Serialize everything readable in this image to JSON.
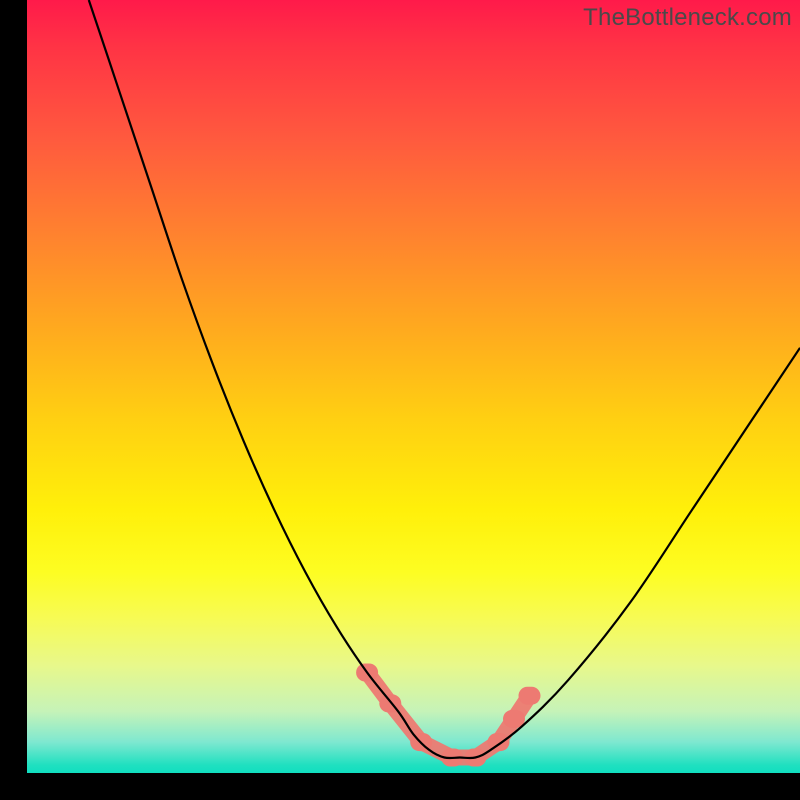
{
  "watermark": "TheBottleneck.com",
  "chart_data": {
    "type": "line",
    "title": "",
    "xlabel": "",
    "ylabel": "",
    "xlim": [
      0,
      100
    ],
    "ylim": [
      0,
      100
    ],
    "series": [
      {
        "name": "bottleneck-curve",
        "x": [
          8,
          12,
          16,
          20,
          24,
          28,
          32,
          36,
          40,
          44,
          48,
          50,
          52,
          54,
          56,
          58,
          60,
          64,
          70,
          78,
          86,
          94,
          100
        ],
        "values": [
          100,
          88,
          76,
          64,
          53,
          43,
          34,
          26,
          19,
          13,
          8,
          5,
          3,
          2,
          2,
          2,
          3,
          6,
          12,
          22,
          34,
          46,
          55
        ]
      }
    ],
    "markers": [
      {
        "name": "marker-a",
        "x": 44,
        "y": 13
      },
      {
        "name": "marker-b",
        "x": 47,
        "y": 9
      },
      {
        "name": "marker-c",
        "x": 51,
        "y": 4
      },
      {
        "name": "marker-d",
        "x": 55,
        "y": 2
      },
      {
        "name": "marker-e",
        "x": 58,
        "y": 2
      },
      {
        "name": "marker-f",
        "x": 61,
        "y": 4
      },
      {
        "name": "marker-g",
        "x": 63,
        "y": 7
      },
      {
        "name": "marker-h",
        "x": 65,
        "y": 10
      }
    ],
    "marker_color": "#ed7a72",
    "curve_color": "#000000",
    "gradient_stops": [
      {
        "pct": 0,
        "color": "#ff1a4a"
      },
      {
        "pct": 50,
        "color": "#ffcf12"
      },
      {
        "pct": 80,
        "color": "#f7fb55"
      },
      {
        "pct": 100,
        "color": "#10dec0"
      }
    ]
  }
}
